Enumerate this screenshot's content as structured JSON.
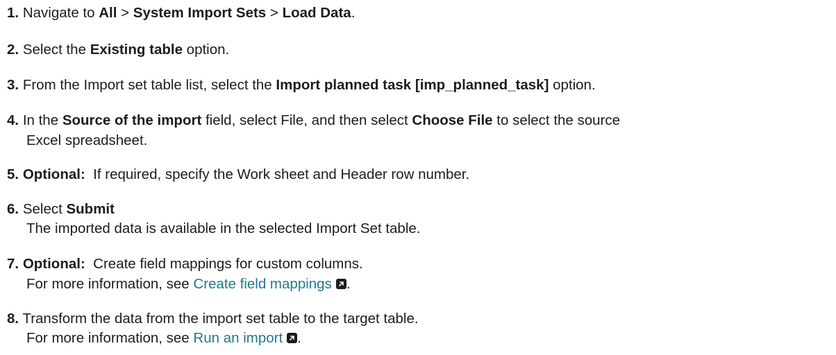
{
  "steps": [
    {
      "num": "1.",
      "t1": "Navigate to ",
      "b1": "All",
      "t2": " > ",
      "b2": "System Import Sets",
      "t3": " > ",
      "b3": "Load Data",
      "t4": "."
    },
    {
      "num": "2.",
      "t1": "Select the ",
      "b1": "Existing table",
      "t2": " option."
    },
    {
      "num": "3.",
      "t1": "From the Import set table list, select the ",
      "b1": "Import planned task [imp_planned_task]",
      "t2": " option."
    },
    {
      "num": "4.",
      "t1": "In the ",
      "b1": "Source of the import",
      "t2": " field, select File, and then select ",
      "b2": "Choose File",
      "t3": " to select the source",
      "cont": "Excel spreadsheet."
    },
    {
      "num": "5.",
      "b1": "Optional:",
      "t1": "  If required, specify the Work sheet and Header row number."
    },
    {
      "num": "6.",
      "t1": "Select ",
      "b1": "Submit",
      "cont": "The imported data is available in the selected Import Set table."
    },
    {
      "num": "7.",
      "b1": "Optional:",
      "t1": "  Create field mappings for custom columns.",
      "cont": "For more information, see ",
      "link": "Create field mappings",
      "after": "."
    },
    {
      "num": "8.",
      "t1": "Transform the data from the import set table to the target table.",
      "cont": "For more information, see ",
      "link": "Run an import",
      "after": "."
    }
  ]
}
